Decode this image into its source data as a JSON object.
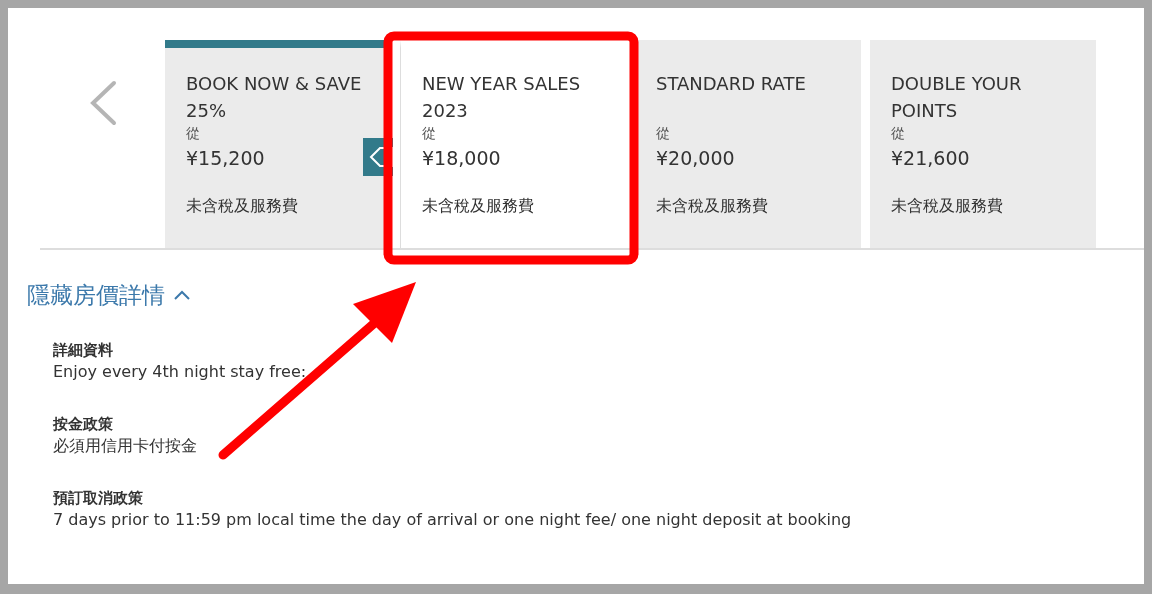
{
  "rates": [
    {
      "title": "BOOK NOW & SAVE 25%",
      "from": "從",
      "price": "¥15,200",
      "note": "未含稅及服務費",
      "selected": true,
      "hovered": false,
      "tag": true
    },
    {
      "title": "NEW YEAR SALES 2023",
      "from": "從",
      "price": "¥18,000",
      "note": "未含稅及服務費",
      "selected": false,
      "hovered": true,
      "tag": false
    },
    {
      "title": "STANDARD RATE",
      "from": "從",
      "price": "¥20,000",
      "note": "未含稅及服務費",
      "selected": false,
      "hovered": false,
      "tag": false
    },
    {
      "title": "DOUBLE YOUR POINTS",
      "from": "從",
      "price": "¥21,600",
      "note": "未含稅及服務費",
      "selected": false,
      "hovered": false,
      "tag": false
    }
  ],
  "toggle": {
    "label": "隱藏房價詳情",
    "expanded": true
  },
  "details": [
    {
      "label": "詳細資料",
      "value": "Enjoy every 4th night stay free:"
    },
    {
      "label": "按金政策",
      "value": "必須用信用卡付按金"
    },
    {
      "label": "預訂取消政策",
      "value": "7 days prior to 11:59 pm local time the day of arrival or one night fee/ one night deposit at booking"
    }
  ]
}
